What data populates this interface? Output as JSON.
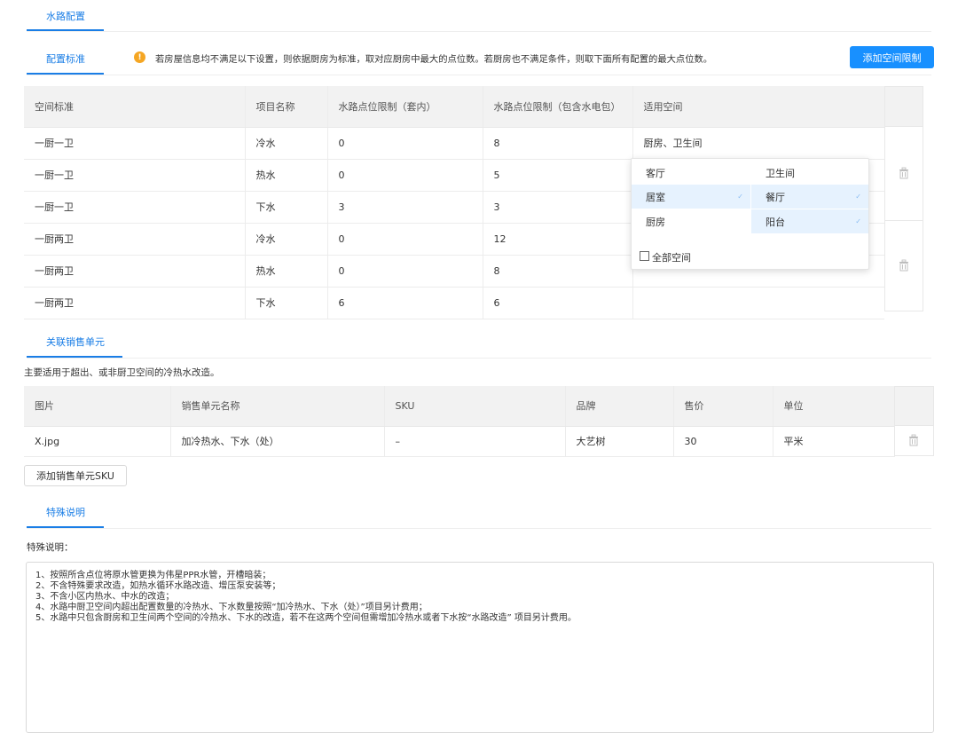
{
  "tabs": {
    "water_config": "水路配置",
    "config_standard": "配置标准",
    "related_sales": "关联销售单元",
    "special_notes": "特殊说明"
  },
  "notice": "若房屋信息均不满足以下设置，则依据厨房为标准，取对应厨房中最大的点位数。若厨房也不满足条件，则取下面所有配置的最大点位数。",
  "add_space_limit_button": "添加空间限制",
  "config_table": {
    "headers": [
      "空间标准",
      "项目名称",
      "水路点位限制（套内）",
      "水路点位限制（包含水电包）",
      "适用空间"
    ],
    "rows": [
      [
        "一厨一卫",
        "冷水",
        "0",
        "8",
        "厨房、卫生间"
      ],
      [
        "一厨一卫",
        "热水",
        "0",
        "5",
        ""
      ],
      [
        "一厨一卫",
        "下水",
        "3",
        "3",
        ""
      ],
      [
        "一厨两卫",
        "冷水",
        "0",
        "12",
        ""
      ],
      [
        "一厨两卫",
        "热水",
        "0",
        "8",
        ""
      ],
      [
        "一厨两卫",
        "下水",
        "6",
        "6",
        ""
      ]
    ]
  },
  "space_dropdown": {
    "options": [
      {
        "label": "客厅",
        "selected": false
      },
      {
        "label": "卫生间",
        "selected": false
      },
      {
        "label": "居室",
        "selected": true
      },
      {
        "label": "餐厅",
        "selected": true
      },
      {
        "label": "厨房",
        "selected": false
      },
      {
        "label": "阳台",
        "selected": true
      }
    ],
    "all_label": "全部空间",
    "check_mark": "✓"
  },
  "sales_description": "主要适用于超出、或非厨卫空间的冷热水改造。",
  "sales_table": {
    "headers": [
      "图片",
      "销售单元名称",
      "SKU",
      "品牌",
      "售价",
      "单位"
    ],
    "rows": [
      [
        "X.jpg",
        "加冷热水、下水（处）",
        "–",
        "大艺树",
        "30",
        "平米"
      ]
    ]
  },
  "add_sku_button": "添加销售单元SKU",
  "special_label": "特殊说明：",
  "special_lines": [
    "1、按照所含点位将原水管更换为伟星PPR水管，开槽暗装；",
    "2、不含特殊要求改造，如热水循环水路改造、增压泵安装等；",
    "3、不含小区内热水、中水的改造；",
    "4、水路中厨卫空间内超出配置数量的冷热水、下水数量按照“加冷热水、下水（处）”项目另计费用；",
    "5、水路中只包含厨房和卫生间两个空间的冷热水、下水的改造，若不在这两个空间但需增加冷热水或者下水按“水路改造” 项目另计费用。"
  ],
  "colors": {
    "accent": "#1890ff",
    "tab_blue": "#1a7ee6",
    "warning": "#f5a623",
    "selected_bg": "#e6f2fe"
  },
  "icons": {
    "warning": "warning-icon",
    "delete": "trash-icon",
    "check": "check-icon"
  }
}
